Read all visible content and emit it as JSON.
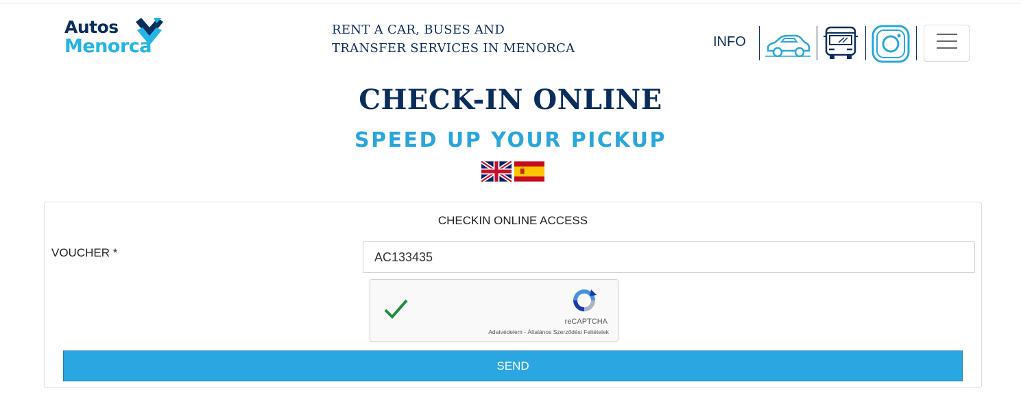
{
  "colors": {
    "brand_navy": "#0a2d5c",
    "brand_blue": "#25b4e6",
    "subtitle_blue": "#2aa6da",
    "send_button": "#2aa6e0",
    "captcha_check": "#1e8e3e"
  },
  "header": {
    "logo": {
      "line1": "Autos",
      "line2": "Menorca"
    },
    "tagline": {
      "line1": "RENT A CAR, BUSES AND",
      "line2": "TRANSFER SERVICES IN MENORCA"
    },
    "nav": {
      "info_label": "INFO",
      "icons": [
        "car-icon",
        "bus-icon",
        "instagram-icon",
        "hamburger-menu-icon"
      ]
    }
  },
  "page": {
    "title": "CHECK-IN ONLINE",
    "subtitle": "SPEED UP YOUR PICKUP",
    "languages": [
      "english-flag-icon",
      "spanish-flag-icon"
    ]
  },
  "form": {
    "panel_title": "CHECKIN ONLINE ACCESS",
    "voucher_label": "VOUCHER *",
    "voucher_value": "AC133435",
    "captcha": {
      "brand": "reCAPTCHA",
      "links": "Adatvédelem - Általános Szerződési Feltételek",
      "checked": true
    },
    "submit_label": "SEND"
  }
}
